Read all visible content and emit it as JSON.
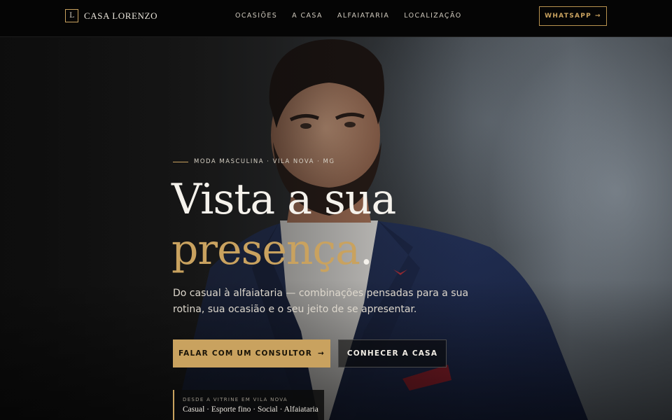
{
  "header": {
    "brand_mark": "L",
    "brand_name": "CASA LORENZO",
    "nav": [
      {
        "label": "OCASIÕES"
      },
      {
        "label": "A CASA"
      },
      {
        "label": "ALFAIATARIA"
      },
      {
        "label": "LOCALIZAÇÃO"
      }
    ],
    "whatsapp_label": "WHATSAPP",
    "whatsapp_arrow": "→"
  },
  "hero": {
    "eyebrow": "MODA MASCULINA · VILA NOVA · MG",
    "headline_line1": "Vista a sua",
    "headline_line2": "presença",
    "headline_dot": ".",
    "subtitle": "Do casual à alfaiataria — combinações pensadas para a sua rotina, sua ocasião e o seu jeito de se apresentar.",
    "cta_primary": "FALAR COM UM CONSULTOR",
    "cta_primary_arrow": "→",
    "cta_secondary": "CONHECER A CASA",
    "since_label": "DESDE A VITRINE EM VILA NOVA",
    "since_list": "Casual · Esporte fino · Social · Alfaiataria"
  },
  "colors": {
    "accent_gold": "#c9a25f",
    "nav_bg": "#050505",
    "suit_navy": "#1f2c4f"
  }
}
